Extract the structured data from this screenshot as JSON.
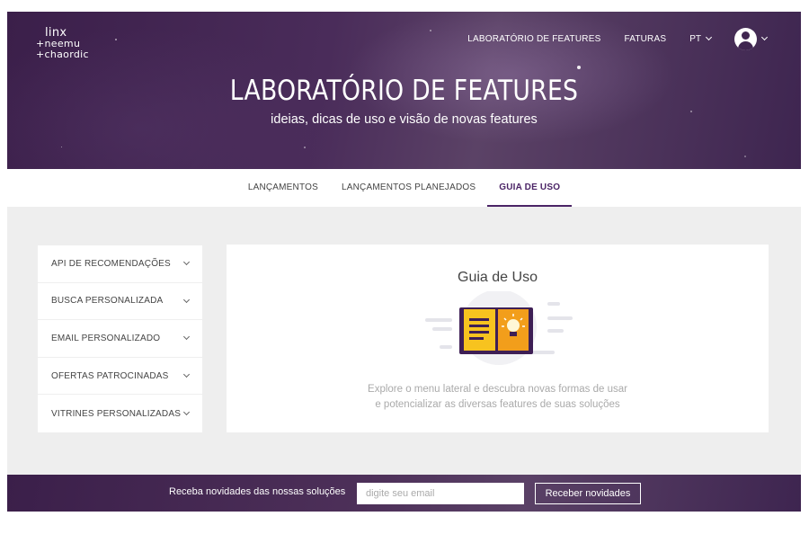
{
  "logo": {
    "line1": "linx",
    "line2": "+neemu",
    "line3": "+chaordic"
  },
  "topnav": {
    "lab": "LABORATÓRIO DE FEATURES",
    "faturas": "FATURAS",
    "lang": "PT"
  },
  "hero": {
    "title": "LABORATÓRIO DE FEATURES",
    "subtitle": "ideias, dicas de uso e visão de novas features"
  },
  "tabs": [
    {
      "label": "LANÇAMENTOS",
      "active": false
    },
    {
      "label": "LANÇAMENTOS PLANEJADOS",
      "active": false
    },
    {
      "label": "GUIA DE USO",
      "active": true
    }
  ],
  "sidebar": {
    "items": [
      {
        "label": "API DE RECOMENDAÇÕES"
      },
      {
        "label": "BUSCA PERSONALIZADA"
      },
      {
        "label": "EMAIL PERSONALIZADO"
      },
      {
        "label": "OFERTAS PATROCINADAS"
      },
      {
        "label": "VITRINES PERSONALIZADAS"
      }
    ]
  },
  "main": {
    "title": "Guia de Uso",
    "text_line1": "Explore o menu lateral e descubra novas formas de usar",
    "text_line2": "e potencializar as diversas features de suas soluções"
  },
  "footer": {
    "text": "Receba novidades das nossas soluções",
    "email_placeholder": "digite seu email",
    "button": "Receber novidades"
  },
  "colors": {
    "brand_purple": "#4b2466",
    "hero_dark": "#3b1f4a",
    "illustration_yellow": "#f7c31f",
    "illustration_orange": "#f29e1b",
    "background_gray": "#eeeeee"
  },
  "icons": [
    "user-avatar-icon",
    "chevron-down-icon",
    "open-book-lightbulb-illustration"
  ]
}
